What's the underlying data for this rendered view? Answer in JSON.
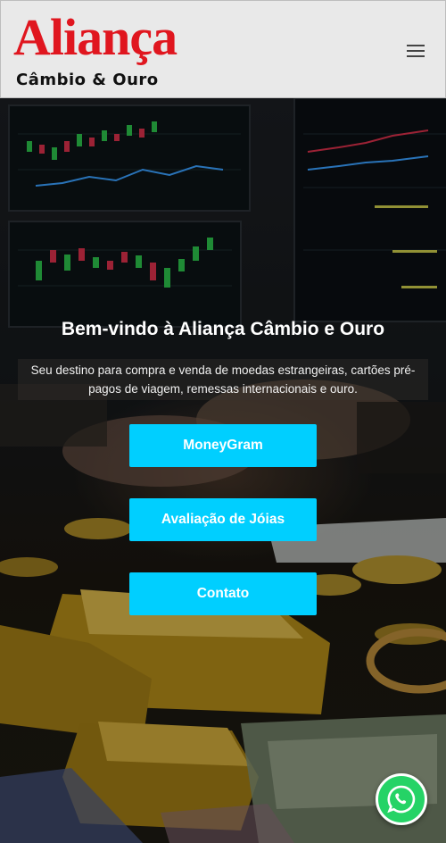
{
  "header": {
    "brand_name": "Aliança",
    "brand_tagline": "Câmbio & Ouro",
    "menu_icon": "hamburger-menu-icon"
  },
  "hero": {
    "title": "Bem-vindo à Aliança Câmbio e Ouro",
    "description": "Seu destino para compra e venda de moedas estrangeiras, cartões pré-pagos de viagem, remessas internacionais e ouro.",
    "buttons": [
      {
        "label": "MoneyGram"
      },
      {
        "label": "Avaliação de Jóias"
      },
      {
        "label": "Contato"
      }
    ]
  },
  "floating": {
    "whatsapp_icon": "whatsapp-icon"
  },
  "colors": {
    "brand_red": "#e0161f",
    "cta_blue": "#00cfff",
    "whatsapp_green": "#25d366"
  }
}
